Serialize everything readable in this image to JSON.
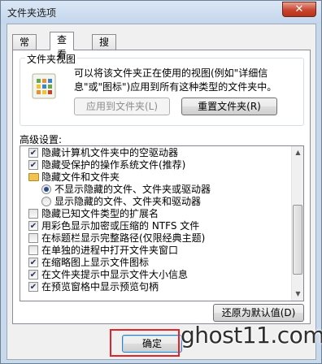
{
  "window": {
    "title": "文件夹选项",
    "close_glyph": "✕"
  },
  "tabs": [
    {
      "label": "常规"
    },
    {
      "label": "查看"
    },
    {
      "label": "搜索"
    }
  ],
  "folder_views": {
    "label": "文件夹视图",
    "description": "可以将该文件夹正在使用的视图(例如\"详细信息\"或\"图标\")应用到所有这种类型的文件夹中。",
    "apply_button": "应用到文件夹(L)",
    "reset_button": "重置文件夹(R)"
  },
  "advanced": {
    "label": "高级设置:",
    "items": [
      {
        "kind": "checkbox",
        "checked": true,
        "label": "隐藏计算机文件夹中的空驱动器"
      },
      {
        "kind": "checkbox",
        "checked": true,
        "label": "隐藏受保护的操作系统文件(推荐)"
      },
      {
        "kind": "folder",
        "label": "隐藏文件和文件夹"
      },
      {
        "kind": "radio",
        "checked": true,
        "label": "不显示隐藏的文件、文件夹或驱动器"
      },
      {
        "kind": "radio",
        "checked": false,
        "label": "显示隐藏的文件、文件夹和驱动器"
      },
      {
        "kind": "checkbox",
        "checked": false,
        "label": "隐藏已知文件类型的扩展名"
      },
      {
        "kind": "checkbox",
        "checked": true,
        "label": "用彩色显示加密或压缩的 NTFS 文件"
      },
      {
        "kind": "checkbox",
        "checked": false,
        "label": "在标题栏显示完整路径(仅限经典主题)"
      },
      {
        "kind": "checkbox",
        "checked": false,
        "label": "在单独的进程中打开文件夹窗口"
      },
      {
        "kind": "checkbox",
        "checked": true,
        "label": "在缩略图上显示文件图标"
      },
      {
        "kind": "checkbox",
        "checked": true,
        "label": "在文件夹提示中显示文件大小信息"
      },
      {
        "kind": "checkbox",
        "checked": true,
        "label": "在预览窗格中显示预览句柄"
      }
    ],
    "restore_button": "还原为默认值(D)"
  },
  "footer": {
    "ok_button": "确定"
  },
  "watermark": "ghost11.com",
  "colors": {
    "highlight": "#e0242a"
  }
}
